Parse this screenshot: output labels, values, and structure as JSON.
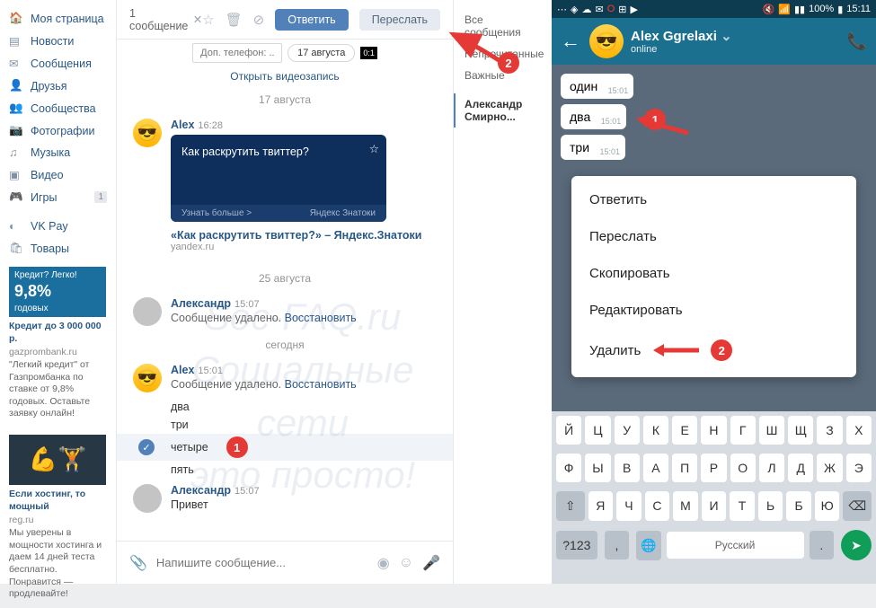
{
  "sidebar": {
    "items": [
      {
        "icon": "🏠",
        "label": "Моя страница"
      },
      {
        "icon": "📰",
        "label": "Новости"
      },
      {
        "icon": "✉",
        "label": "Сообщения"
      },
      {
        "icon": "👥",
        "label": "Друзья"
      },
      {
        "icon": "👥",
        "label": "Сообщества"
      },
      {
        "icon": "📷",
        "label": "Фотографии"
      },
      {
        "icon": "🎵",
        "label": "Музыка"
      },
      {
        "icon": "▶",
        "label": "Видео"
      },
      {
        "icon": "🎮",
        "label": "Игры",
        "badge": "1"
      },
      {
        "icon": "◐",
        "label": "VK Pay"
      },
      {
        "icon": "🛍",
        "label": "Товары"
      }
    ]
  },
  "ads": {
    "a1": {
      "img_line1": "Кредит? Легко!",
      "img_line2": "9,8%",
      "img_line3": "годовых",
      "title": "Кредит до 3 000 000 р.",
      "sub": "gazprombank.ru",
      "body": "\"Легкий кредит\" от Газпромбанка по ставке от 9,8% годовых. Оставьте заявку онлайн!"
    },
    "a2": {
      "title": "Если хостинг, то мощный",
      "sub": "reg.ru",
      "body": "Мы уверены в мощности хостинга и даем 14 дней теста бесплатно. Понравится — продлевайте!"
    }
  },
  "toolbar": {
    "title": "1 сообщение",
    "close": "✕",
    "reply": "Ответить",
    "forward": "Переслать"
  },
  "phone": {
    "placeholder": "Доп. телефон: ...",
    "date_btn": "17 августа",
    "video": "Открыть видеозапись",
    "sep1": "17 августа"
  },
  "msg1": {
    "name": "Alex",
    "time": "16:28",
    "card_q": "Как раскрутить твиттер?",
    "card_more": "Узнать больше >",
    "card_brand": "Яндекс Знатоки",
    "link_t": "«Как раскрутить твиттер?» – Яндекс.Знатоки",
    "link_d": "yandex.ru"
  },
  "sep2": "25 августа",
  "msg2": {
    "name": "Александр",
    "time": "15:07",
    "text": "Сообщение удалено.",
    "restore": "Восстановить"
  },
  "sep3": "сегодня",
  "msg3": {
    "name": "Alex",
    "time": "15:01",
    "text": "Сообщение удалено.",
    "restore": "Восстановить"
  },
  "mini": {
    "m1": "два",
    "m2": "три",
    "m3": "четыре",
    "m4": "пять"
  },
  "msg4": {
    "name": "Александр",
    "time": "15:07",
    "text": "Привет"
  },
  "compose": {
    "placeholder": "Напишите сообщение..."
  },
  "rpanel": {
    "i1": "Все сообщения",
    "i2": "Непрочитанные",
    "i3": "Важные",
    "i4": "Александр Смирно..."
  },
  "watermark": {
    "l1": "Soc-FAQ.ru",
    "l2": "Социальные сети",
    "l3": "это просто!"
  },
  "mobile": {
    "status": {
      "battery": "100%",
      "time": "15:11"
    },
    "header": {
      "name": "Alex Ggrelaxi",
      "status": "online"
    },
    "bubbles": {
      "b1": "один",
      "b1t": "15:01",
      "b2": "два",
      "b2t": "15:01",
      "b3": "три",
      "b3t": "15:01"
    },
    "menu": {
      "i1": "Ответить",
      "i2": "Переслать",
      "i3": "Скопировать",
      "i4": "Редактировать",
      "i5": "Удалить"
    },
    "kb": {
      "row1": [
        "Й",
        "Ц",
        "У",
        "К",
        "Е",
        "Н",
        "Г",
        "Ш",
        "Щ",
        "З",
        "Х"
      ],
      "row2": [
        "Ф",
        "Ы",
        "В",
        "А",
        "П",
        "Р",
        "О",
        "Л",
        "Д",
        "Ж",
        "Э"
      ],
      "row3": [
        "Я",
        "Ч",
        "С",
        "М",
        "И",
        "Т",
        "Ь",
        "Б",
        "Ю"
      ],
      "num": "?123",
      "space": "Русский"
    }
  },
  "badges": {
    "n1": "1",
    "n2": "2"
  }
}
